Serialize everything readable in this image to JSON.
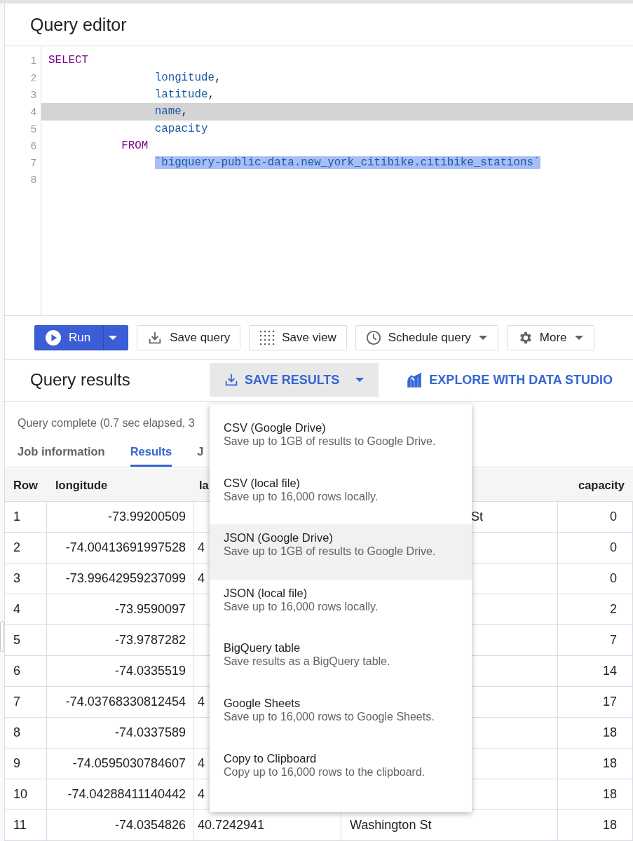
{
  "editor": {
    "title": "Query editor",
    "lines": [
      {
        "number": "1",
        "current": false,
        "tokens": [
          {
            "text": "SELECT",
            "kind": "keyword",
            "selected": false
          }
        ]
      },
      {
        "number": "2",
        "current": false,
        "tokens": [
          {
            "text": "                longitude",
            "kind": "identifier",
            "selected": false
          },
          {
            "text": ",",
            "kind": "punct",
            "selected": false
          }
        ]
      },
      {
        "number": "3",
        "current": false,
        "tokens": [
          {
            "text": "                latitude",
            "kind": "identifier",
            "selected": false
          },
          {
            "text": ",",
            "kind": "punct",
            "selected": false
          }
        ]
      },
      {
        "number": "4",
        "current": true,
        "tokens": [
          {
            "text": "                name",
            "kind": "identifier",
            "selected": false
          },
          {
            "text": ",",
            "kind": "punct",
            "selected": false
          }
        ]
      },
      {
        "number": "5",
        "current": false,
        "tokens": [
          {
            "text": "                capacity",
            "kind": "identifier",
            "selected": false
          }
        ]
      },
      {
        "number": "6",
        "current": false,
        "tokens": [
          {
            "text": "           FROM",
            "kind": "keyword",
            "selected": false
          }
        ]
      },
      {
        "number": "7",
        "current": false,
        "tokens": [
          {
            "text": "                `bigquery-public-data.new_york_citibike.citibike_stations`",
            "kind": "string",
            "selected": true
          }
        ]
      },
      {
        "number": "8",
        "current": false
      }
    ]
  },
  "toolbar": [
    {
      "label": "Run",
      "kind": "primary",
      "dropdown": true
    },
    {
      "label": "Save query",
      "kind": "normal",
      "dropdown": false
    },
    {
      "label": "Save view",
      "kind": "normal",
      "dropdown": false
    },
    {
      "label": "Schedule query",
      "kind": "normal",
      "dropdown": true
    },
    {
      "label": "More",
      "kind": "normal",
      "dropdown": true
    }
  ],
  "results": {
    "title": "Query results",
    "save_button": {
      "label": "SAVE RESULTS",
      "open": true
    },
    "explore_link": "EXPLORE WITH DATA STUDIO",
    "status": "Query complete (0.7 sec elapsed, 3",
    "tabs": [
      {
        "label": "Job information",
        "selected": false
      },
      {
        "label": "Results",
        "selected": true
      },
      {
        "label": "J",
        "selected": false
      }
    ]
  },
  "table": {
    "columns": [
      "Row",
      "longitude",
      "la",
      null,
      "capacity"
    ],
    "rows": [
      [
        "1",
        "-73.99200509",
        null,
        "St",
        "0"
      ],
      [
        "2",
        "-74.00413691997528",
        "4",
        null,
        "0"
      ],
      [
        "3",
        "-73.99642959237099",
        "4",
        null,
        "0"
      ],
      [
        "4",
        "-73.9590097",
        null,
        null,
        "2"
      ],
      [
        "5",
        "-73.9787282",
        null,
        null,
        "7"
      ],
      [
        "6",
        "-74.0335519",
        null,
        null,
        "14"
      ],
      [
        "7",
        "-74.03768330812454",
        "4",
        null,
        "17"
      ],
      [
        "8",
        "-74.0337589",
        null,
        null,
        "18"
      ],
      [
        "9",
        "-74.0595030784607",
        "4",
        null,
        "18"
      ],
      [
        "10",
        "-74.04288411140442",
        "4",
        null,
        "18"
      ],
      [
        "11",
        "-74.0354826",
        "40.7242941",
        "Washington St",
        "18"
      ]
    ]
  },
  "save_menu": [
    {
      "title": "CSV (Google Drive)",
      "description": "Save up to 1GB of results to Google Drive.",
      "highlighted": false
    },
    {
      "title": "CSV (local file)",
      "description": "Save up to 16,000 rows locally.",
      "highlighted": false
    },
    {
      "title": "JSON (Google Drive)",
      "description": "Save up to 1GB of results to Google Drive.",
      "highlighted": true
    },
    {
      "title": "JSON (local file)",
      "description": "Save up to 16,000 rows locally.",
      "highlighted": false
    },
    {
      "title": "BigQuery table",
      "description": "Save results as a BigQuery table.",
      "highlighted": false
    },
    {
      "title": "Google Sheets",
      "description": "Save up to 16,000 rows to Google Sheets.",
      "highlighted": false
    },
    {
      "title": "Copy to Clipboard",
      "description": "Copy up to 16,000 rows to the clipboard.",
      "highlighted": false
    }
  ]
}
